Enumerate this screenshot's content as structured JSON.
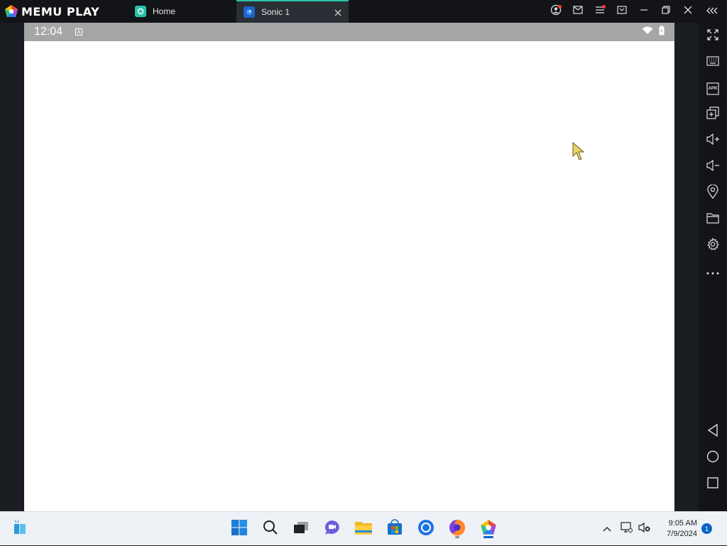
{
  "app": {
    "brand": "MEMU PLAY",
    "tabs": [
      {
        "label": "Home",
        "icon": "home-tab-icon"
      },
      {
        "label": "Sonic 1",
        "icon": "sonic-app-icon"
      }
    ],
    "accent": "#27c3a6"
  },
  "titlebar_actions": [
    "account-icon",
    "mail-icon",
    "menu-icon",
    "screen-cast-icon",
    "minimize-icon",
    "restore-icon",
    "close-icon",
    "collapse-sidebar-icon"
  ],
  "android": {
    "time": "12:04",
    "notification_icon": "A"
  },
  "sidebar": [
    "fullscreen-icon",
    "keyboard-icon",
    "apk-icon",
    "multi-instance-icon",
    "volume-up-icon",
    "volume-down-icon",
    "location-icon",
    "folder-icon",
    "settings-icon",
    "more-icon"
  ],
  "sidebar_nav": [
    "back-icon",
    "home-icon",
    "recents-icon"
  ],
  "apk_label": "APK",
  "taskbar": {
    "time": "9:05 AM",
    "date": "7/9/2024",
    "notification_count": "1"
  }
}
